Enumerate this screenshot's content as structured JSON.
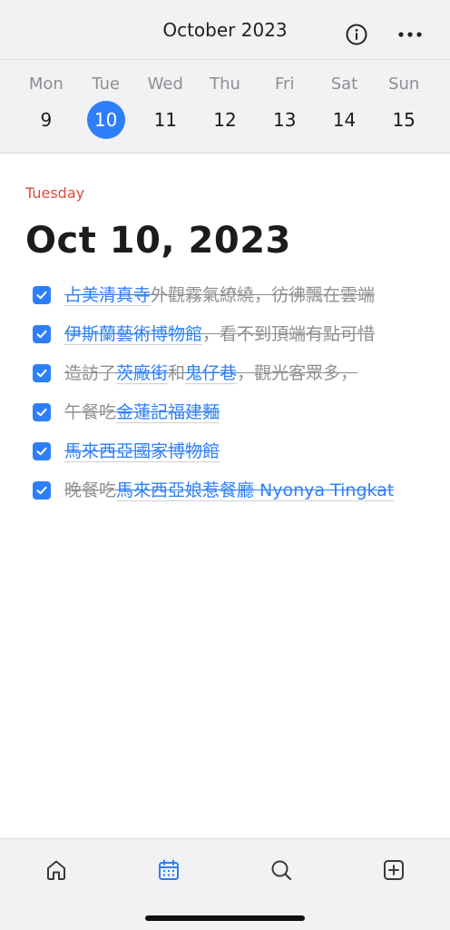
{
  "header": {
    "month_title": "October 2023",
    "icons": [
      "info-icon",
      "more-icon"
    ]
  },
  "week": [
    {
      "dow": "Mon",
      "num": "9",
      "selected": false
    },
    {
      "dow": "Tue",
      "num": "10",
      "selected": true
    },
    {
      "dow": "Wed",
      "num": "11",
      "selected": false
    },
    {
      "dow": "Thu",
      "num": "12",
      "selected": false
    },
    {
      "dow": "Fri",
      "num": "13",
      "selected": false
    },
    {
      "dow": "Sat",
      "num": "14",
      "selected": false
    },
    {
      "dow": "Sun",
      "num": "15",
      "selected": false
    }
  ],
  "main": {
    "weekday": "Tuesday",
    "date_title": "Oct 10, 2023",
    "tasks": [
      {
        "checked": true,
        "parts": [
          {
            "link": "占美清真寺"
          },
          {
            "text": "外觀霧氣繚繞，彷彿飄在雲端"
          }
        ]
      },
      {
        "checked": true,
        "parts": [
          {
            "link": "伊斯蘭藝術博物館"
          },
          {
            "text": "，看不到頂端有點可惜"
          }
        ]
      },
      {
        "checked": true,
        "parts": [
          {
            "text": "造訪了"
          },
          {
            "link": "茨廠街"
          },
          {
            "text": "和"
          },
          {
            "link": "鬼仔巷"
          },
          {
            "text": "，觀光客眾多，"
          }
        ]
      },
      {
        "checked": true,
        "parts": [
          {
            "text": "午餐吃"
          },
          {
            "link": "金蓮記福建麵"
          }
        ]
      },
      {
        "checked": true,
        "parts": [
          {
            "link": "馬來西亞國家博物館"
          }
        ]
      },
      {
        "checked": true,
        "parts": [
          {
            "text": "晚餐吃"
          },
          {
            "link": "馬來西亞娘惹餐廳 Nyonya Tingkat"
          }
        ]
      }
    ]
  },
  "tabbar": {
    "items": [
      "home-icon",
      "calendar-icon",
      "search-icon",
      "add-icon"
    ],
    "active": "calendar-icon"
  },
  "colors": {
    "accent": "#2d7ff9",
    "weekday_red": "#e04a3f",
    "muted_text": "#8e8e93"
  }
}
